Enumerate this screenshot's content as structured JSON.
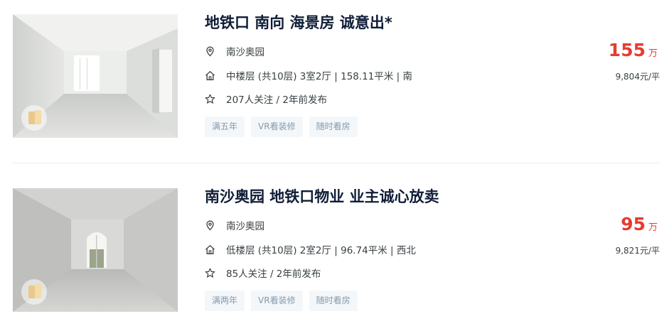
{
  "listings": [
    {
      "title": "地铁口 南向 海景房 诚意出*",
      "community": "南沙奥园",
      "house_info": "中楼层 (共10层) 3室2厅 | 158.11平米 | 南",
      "follow_info": "207人关注 / 2年前发布",
      "tags": [
        "满五年",
        "VR看装修",
        "随时看房"
      ],
      "total_price": "155",
      "total_price_unit": "万",
      "unit_price": "9,804元/平",
      "thumbnail": "empty-room-photo-bright-window"
    },
    {
      "title": "南沙奥园 地铁口物业 业主诚心放卖",
      "community": "南沙奥园",
      "house_info": "低楼层 (共10层) 2室2厅 | 96.74平米 | 西北",
      "follow_info": "85人关注 / 2年前发布",
      "tags": [
        "满两年",
        "VR看装修",
        "随时看房"
      ],
      "total_price": "95",
      "total_price_unit": "万",
      "unit_price": "9,821元/平",
      "thumbnail": "empty-room-photo-arched-door"
    }
  ],
  "icons": {
    "location": "location-pin-icon",
    "house": "house-icon",
    "follow": "star-icon"
  },
  "colors": {
    "price": "#e63c30",
    "title": "#101d37",
    "tag_text": "#849aae",
    "tag_bg": "#f4f7f9"
  }
}
